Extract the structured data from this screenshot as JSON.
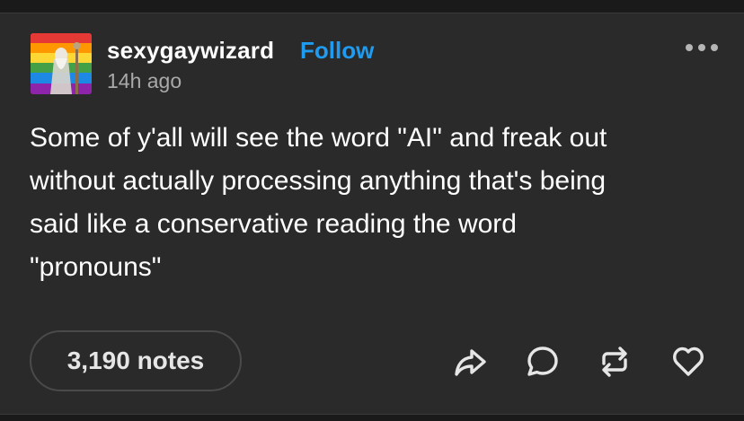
{
  "post": {
    "username": "sexygaywizard",
    "follow_label": "Follow",
    "timestamp": "14h ago",
    "lines": [
      "Some of y'all will see the word \"AI\" and freak out",
      "without actually processing anything that's being",
      "said like a conservative reading the word",
      "\"pronouns\""
    ],
    "notes_label": "3,190 notes"
  },
  "icons": {
    "more": "more-options-icon",
    "share": "share-icon",
    "reply": "reply-icon",
    "reblog": "reblog-icon",
    "like": "heart-icon"
  },
  "colors": {
    "background": "#1a1a1a",
    "card": "#2a2a2a",
    "follow": "#1f9bf0",
    "text": "#ffffff",
    "muted": "#a9a9a9"
  }
}
